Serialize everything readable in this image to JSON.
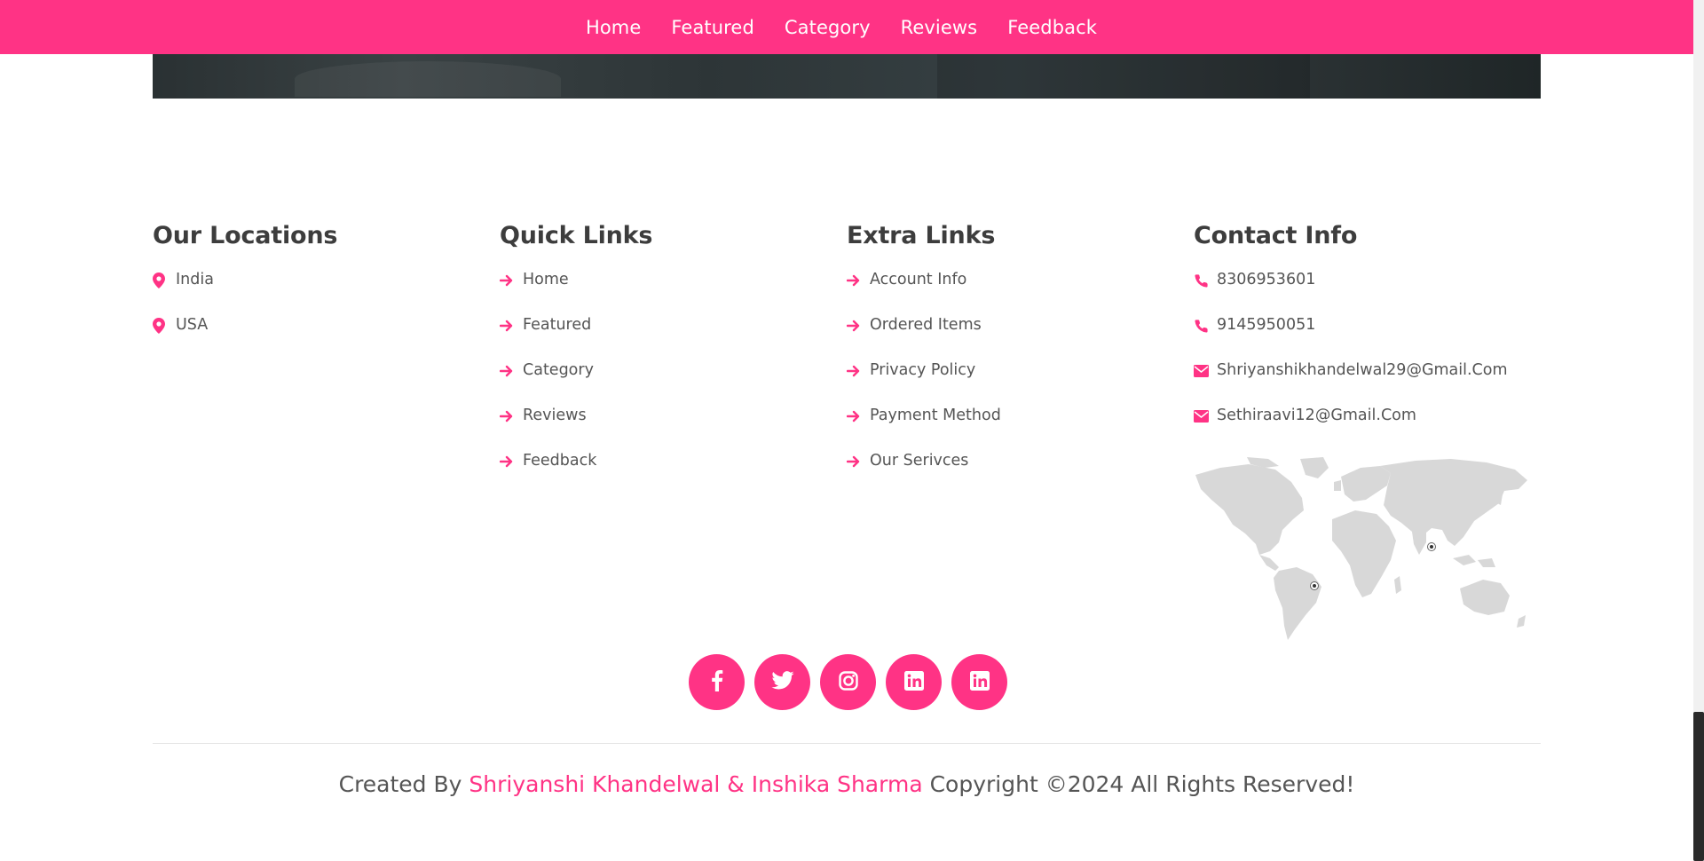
{
  "nav": {
    "items": [
      {
        "label": "Home"
      },
      {
        "label": "Featured"
      },
      {
        "label": "Category"
      },
      {
        "label": "Reviews"
      },
      {
        "label": "Feedback"
      }
    ]
  },
  "footer": {
    "locations": {
      "title": "Our Locations",
      "items": [
        {
          "label": "India",
          "icon": "map-marker-icon"
        },
        {
          "label": "USA",
          "icon": "map-marker-icon"
        }
      ]
    },
    "quick_links": {
      "title": "Quick Links",
      "items": [
        {
          "label": "Home",
          "icon": "arrow-right-icon"
        },
        {
          "label": "Featured",
          "icon": "arrow-right-icon"
        },
        {
          "label": "Category",
          "icon": "arrow-right-icon"
        },
        {
          "label": "Reviews",
          "icon": "arrow-right-icon"
        },
        {
          "label": "Feedback",
          "icon": "arrow-right-icon"
        }
      ]
    },
    "extra_links": {
      "title": "Extra Links",
      "items": [
        {
          "label": "Account Info",
          "icon": "arrow-right-icon"
        },
        {
          "label": "Ordered Items",
          "icon": "arrow-right-icon"
        },
        {
          "label": "Privacy Policy",
          "icon": "arrow-right-icon"
        },
        {
          "label": "Payment Method",
          "icon": "arrow-right-icon"
        },
        {
          "label": "Our Serivces",
          "icon": "arrow-right-icon"
        }
      ]
    },
    "contact": {
      "title": "Contact Info",
      "items": [
        {
          "label": "8306953601",
          "icon": "phone-icon"
        },
        {
          "label": "9145950051",
          "icon": "phone-icon"
        },
        {
          "label": "Shriyanshikhandelwal29@Gmail.Com",
          "icon": "envelope-icon"
        },
        {
          "label": "Sethiraavi12@Gmail.Com",
          "icon": "envelope-icon"
        }
      ],
      "map_icon": "world-map-icon"
    },
    "social": [
      {
        "icon": "facebook-icon"
      },
      {
        "icon": "twitter-icon"
      },
      {
        "icon": "instagram-icon"
      },
      {
        "icon": "linkedin-icon"
      },
      {
        "icon": "linkedin-icon"
      }
    ],
    "credit": {
      "prefix": "Created By ",
      "names": "Shriyanshi Khandelwal & Inshika Sharma",
      "suffix": " Copyright ©2024 All Rights Reserved!"
    }
  },
  "colors": {
    "accent": "#ff3385",
    "heading": "#3d3d3d",
    "text": "#555555"
  }
}
